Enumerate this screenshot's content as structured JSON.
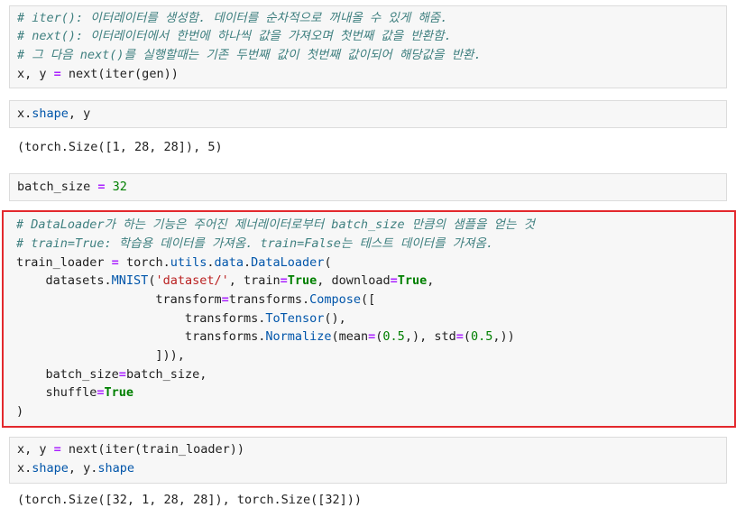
{
  "cell1": {
    "comment1": "# iter(): 이터레이터를 생성함. 데이터를 순차적으로 꺼내올 수 있게 해줌.",
    "comment2": "# next(): 이터레이터에서 한번에 하나씩 값을 가져오며 첫번째 값을 반환함.",
    "comment3": "# 그 다음 next()를 실행할때는 기존 두번째 값이 첫번째 값이되어 해당값을 반환.",
    "code_a": "x, y ",
    "code_eq": "=",
    "code_b": " next(iter(gen))"
  },
  "cell2": {
    "code_x": "x.",
    "code_attr": "shape",
    "code_rest": ", y",
    "output": "(torch.Size([1, 28, 28]), 5)"
  },
  "cell3": {
    "code_a": "batch_size ",
    "code_eq": "=",
    "code_num": " 32"
  },
  "cell4": {
    "comment1": "# DataLoader가 하는 기능은 주어진 제너레이터로부터 batch_size 만큼의 샘플을 얻는 것",
    "comment2": "# train=True: 학습용 데이터를 가져옴. train=False는 테스트 데이터를 가져옴.",
    "l1a": "train_loader ",
    "l1eq": "=",
    "l1b": " torch.",
    "l1c": "utils",
    "l1d": ".",
    "l1e": "data",
    "l1f": ".",
    "l1g": "DataLoader",
    "l1h": "(",
    "l2a": "    datasets.",
    "l2b": "MNIST",
    "l2c": "(",
    "l2d": "'dataset/'",
    "l2e": ", train",
    "l2f": "=",
    "l2g": "True",
    "l2h": ", download",
    "l2i": "=",
    "l2j": "True",
    "l2k": ",",
    "l3a": "                   transform",
    "l3b": "=",
    "l3c": "transforms.",
    "l3d": "Compose",
    "l3e": "([",
    "l4a": "                       transforms.",
    "l4b": "ToTensor",
    "l4c": "(),",
    "l5a": "                       transforms.",
    "l5b": "Normalize",
    "l5c": "(mean",
    "l5d": "=",
    "l5e": "(",
    "l5f": "0.5",
    "l5g": ",), std",
    "l5h": "=",
    "l5i": "(",
    "l5j": "0.5",
    "l5k": ",))",
    "l6": "                   ])),",
    "l7a": "    batch_size",
    "l7b": "=",
    "l7c": "batch_size,",
    "l8a": "    shuffle",
    "l8b": "=",
    "l8c": "True",
    "l9": ")"
  },
  "cell5": {
    "l1a": "x, y ",
    "l1eq": "=",
    "l1b": " next(iter(train_loader))",
    "l2a": "x.",
    "l2b": "shape",
    "l2c": ", y.",
    "l2d": "shape",
    "output": "(torch.Size([32, 1, 28, 28]), torch.Size([32]))"
  }
}
